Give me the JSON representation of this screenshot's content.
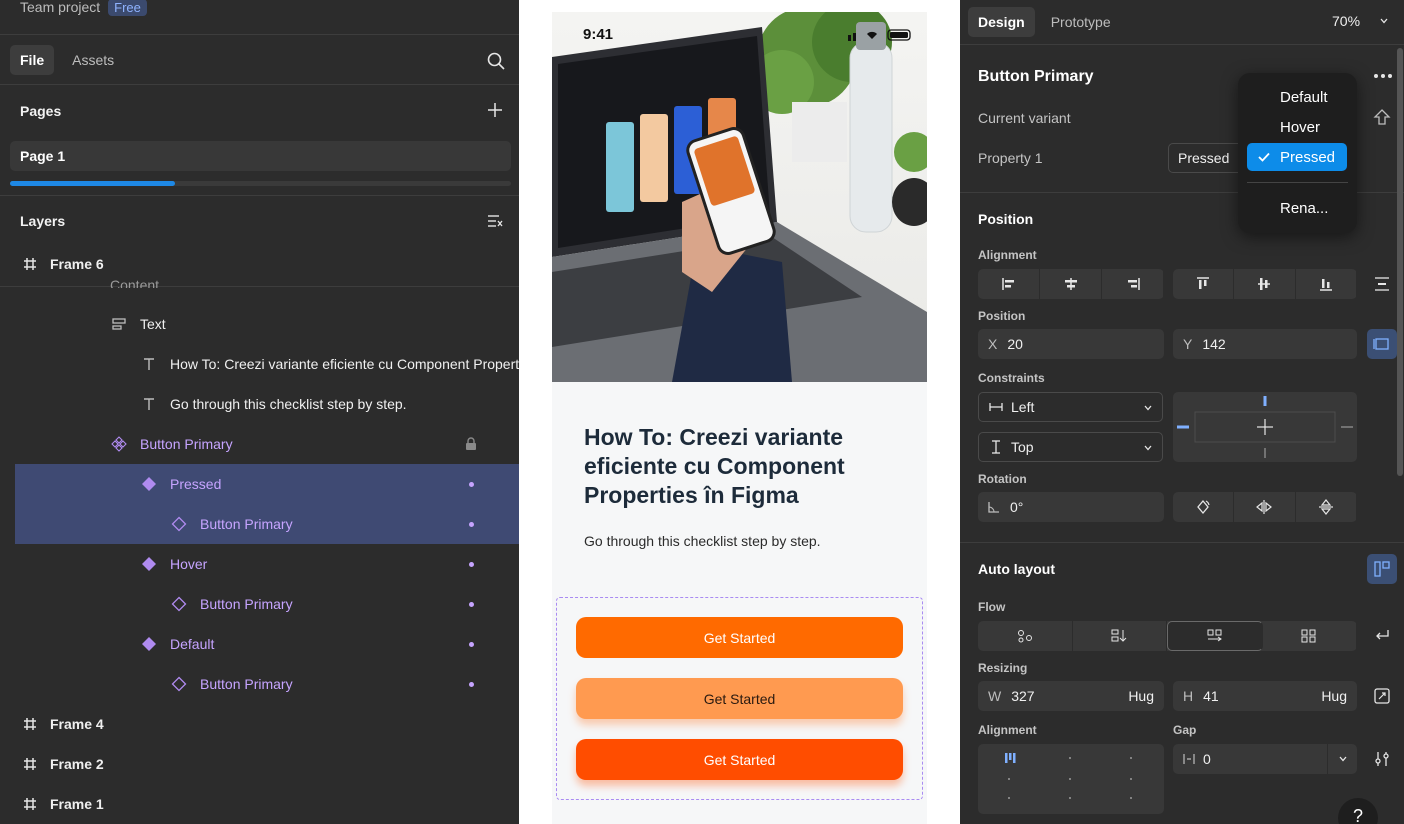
{
  "left": {
    "project": "Team project",
    "plan_badge": "Free",
    "tabs": [
      "File",
      "Assets"
    ],
    "pages_title": "Pages",
    "page": "Page 1",
    "layers_title": "Layers",
    "layers": [
      {
        "label": "Frame 6"
      },
      {
        "label": "Content"
      },
      {
        "label": "Text"
      },
      {
        "label": "How To: Creezi variante eficiente cu Component Properties în Figma"
      },
      {
        "label": "Go through this checklist step by step."
      },
      {
        "label": "Button Primary"
      },
      {
        "label": "Pressed"
      },
      {
        "label": "Button Primary"
      },
      {
        "label": "Hover"
      },
      {
        "label": "Button Primary"
      },
      {
        "label": "Default"
      },
      {
        "label": "Button Primary"
      },
      {
        "label": "Frame 4"
      },
      {
        "label": "Frame 2"
      },
      {
        "label": "Frame 1"
      }
    ]
  },
  "canvas": {
    "time": "9:41",
    "headline": "How To: Creezi variante eficiente cu Component Properties în Figma",
    "subline": "Go through this checklist step by step.",
    "buttons": [
      "Get Started",
      "Get Started",
      "Get Started"
    ],
    "colors": {
      "button_default": "#ff6a00",
      "button_hover": "#ff9a50",
      "button_pressed": "#ff4d00"
    }
  },
  "right": {
    "tabs": [
      "Design",
      "Prototype"
    ],
    "zoom": "70%",
    "component_title": "Button Primary",
    "current_variant_label": "Current variant",
    "property_label": "Property 1",
    "property_value": "Pressed",
    "dropdown": {
      "items": [
        "Default",
        "Hover",
        "Pressed"
      ],
      "selected": "Pressed",
      "rename": "Rena..."
    },
    "position": {
      "title": "Position",
      "alignment_label": "Alignment",
      "position_label": "Position",
      "x_key": "X",
      "x": "20",
      "y_key": "Y",
      "y": "142",
      "constraints_label": "Constraints",
      "constraint_h": "Left",
      "constraint_v": "Top",
      "rotation_label": "Rotation",
      "rotation": "0°"
    },
    "auto_layout": {
      "title": "Auto layout",
      "flow_label": "Flow",
      "resizing_label": "Resizing",
      "w_key": "W",
      "w": "327",
      "w_mode": "Hug",
      "h_key": "H",
      "h": "41",
      "h_mode": "Hug",
      "alignment_label": "Alignment",
      "gap_label": "Gap",
      "gap": "0"
    },
    "help": "?"
  }
}
